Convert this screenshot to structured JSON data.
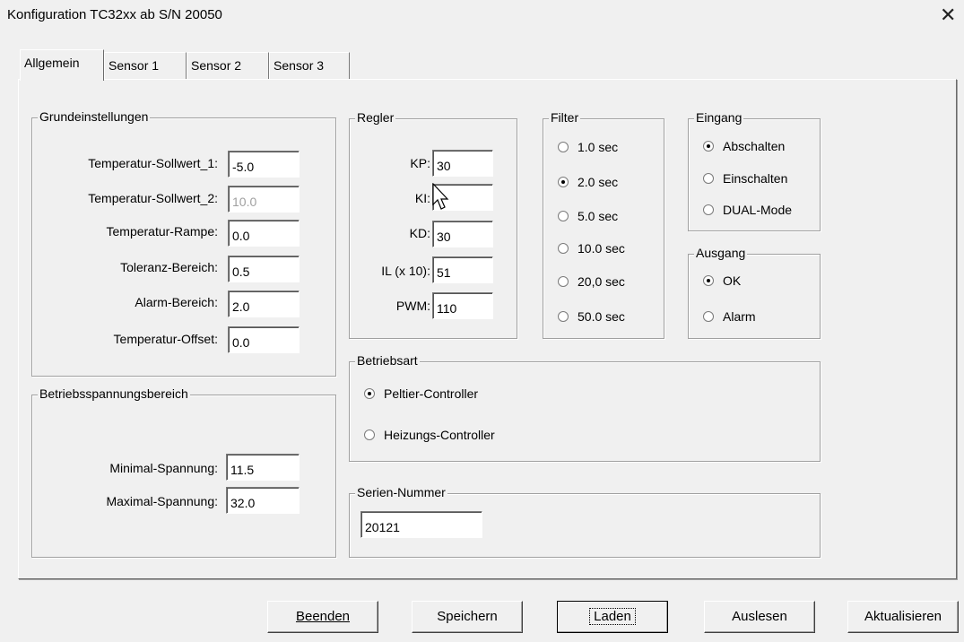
{
  "window": {
    "title": "Konfiguration  TC32xx ab S/N 20050",
    "close_glyph": "✕"
  },
  "tabs": [
    "Allgemein",
    "Sensor 1",
    "Sensor 2",
    "Sensor 3"
  ],
  "active_tab": "Allgemein",
  "grundeinstellungen": {
    "legend": "Grundeinstellungen",
    "rows": [
      {
        "label": "Temperatur-Sollwert_1:",
        "value": "-5.0",
        "disabled": false
      },
      {
        "label": "Temperatur-Sollwert_2:",
        "value": "10.0",
        "disabled": true
      },
      {
        "label": "Temperatur-Rampe:",
        "value": "0.0",
        "disabled": false
      },
      {
        "label": "Toleranz-Bereich:",
        "value": "0.5",
        "disabled": false
      },
      {
        "label": "Alarm-Bereich:",
        "value": "2.0",
        "disabled": false
      },
      {
        "label": "Temperatur-Offset:",
        "value": "0.0",
        "disabled": false
      }
    ]
  },
  "betriebsspannung": {
    "legend": "Betriebsspannungsbereich",
    "rows": [
      {
        "label": "Minimal-Spannung:",
        "value": "11.5"
      },
      {
        "label": "Maximal-Spannung:",
        "value": "32.0"
      }
    ]
  },
  "regler": {
    "legend": "Regler",
    "rows": [
      {
        "label": "KP:",
        "value": "30"
      },
      {
        "label": "KI:",
        "value": ""
      },
      {
        "label": "KD:",
        "value": "30"
      },
      {
        "label": "IL (x 10):",
        "value": "51"
      },
      {
        "label": "PWM:",
        "value": "110"
      }
    ]
  },
  "filter": {
    "legend": "Filter",
    "options": [
      "1.0 sec",
      "2.0 sec",
      "5.0 sec",
      "10.0 sec",
      "20,0 sec",
      "50.0 sec"
    ],
    "selected": "2.0 sec"
  },
  "eingang": {
    "legend": "Eingang",
    "options": [
      "Abschalten",
      "Einschalten",
      "DUAL-Mode"
    ],
    "selected": "Abschalten"
  },
  "ausgang": {
    "legend": "Ausgang",
    "options": [
      "OK",
      "Alarm"
    ],
    "selected": "OK"
  },
  "betriebsart": {
    "legend": "Betriebsart",
    "options": [
      "Peltier-Controller",
      "Heizungs-Controller"
    ],
    "selected": "Peltier-Controller"
  },
  "seriennummer": {
    "legend": "Serien-Nummer",
    "value": "20121"
  },
  "buttons": {
    "beenden": "Beenden",
    "speichern": "Speichern",
    "laden": "Laden",
    "auslesen": "Auslesen",
    "aktualisieren": "Aktualisieren"
  }
}
